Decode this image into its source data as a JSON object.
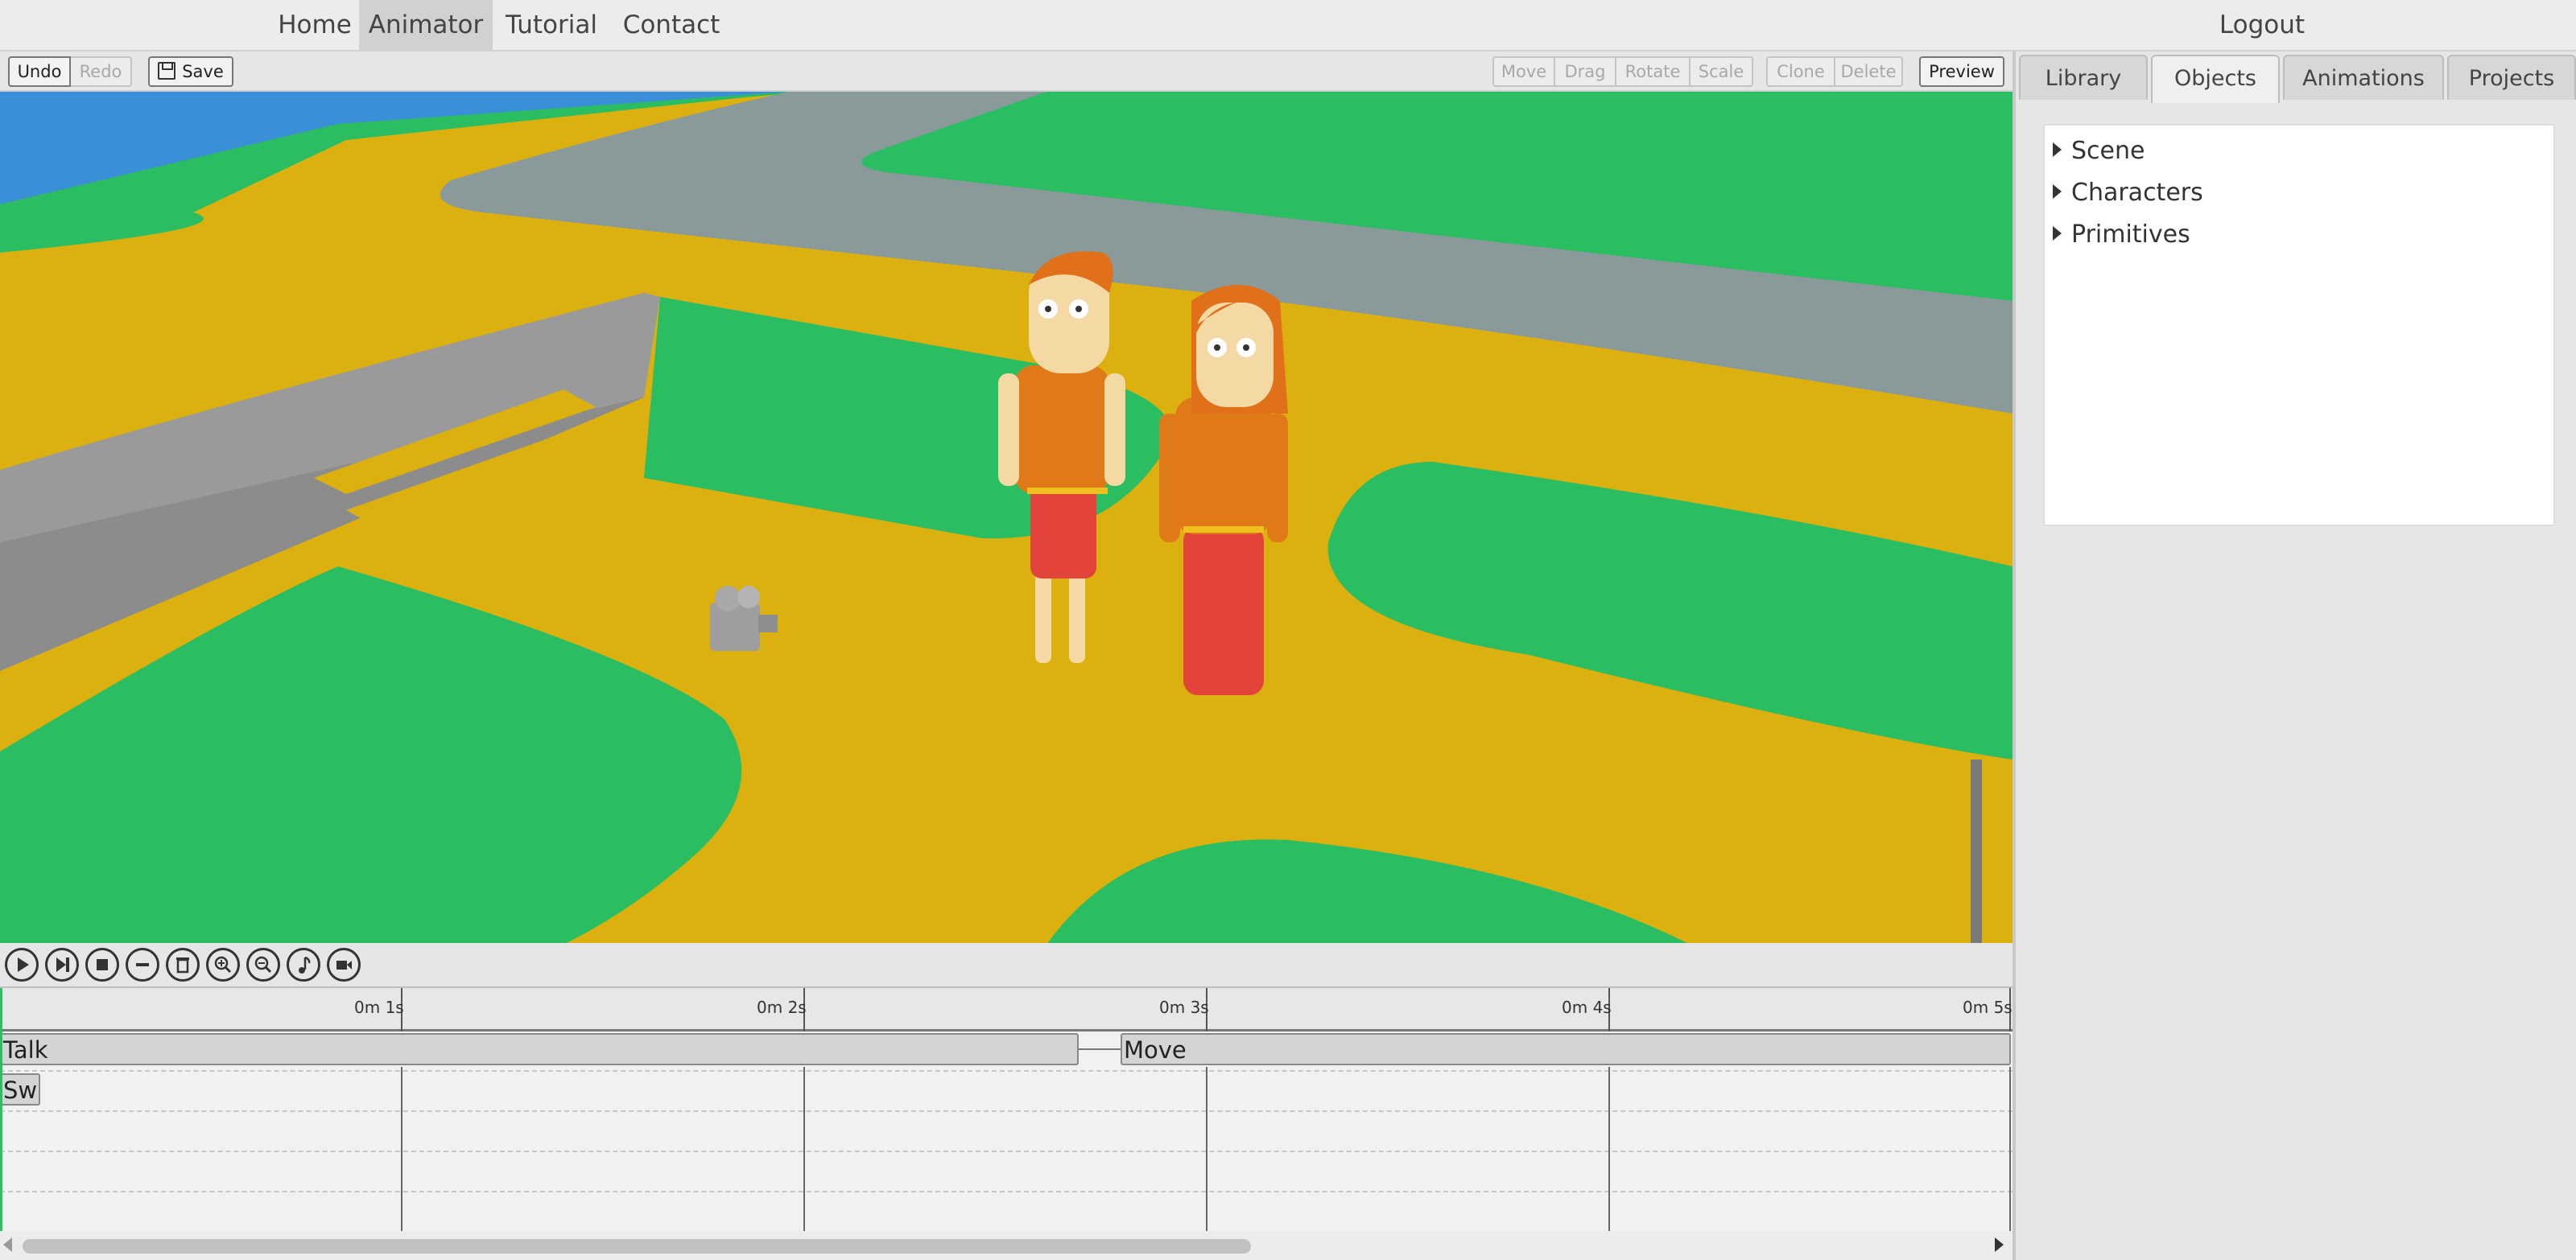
{
  "nav": {
    "home": "Home",
    "animator": "Animator",
    "tutorial": "Tutorial",
    "contact": "Contact",
    "logout": "Logout",
    "active": "Animator"
  },
  "toolbar": {
    "undo": "Undo",
    "redo": "Redo",
    "save": "Save",
    "move": "Move",
    "drag": "Drag",
    "rotate": "Rotate",
    "scale": "Scale",
    "clone": "Clone",
    "delete": "Delete",
    "preview": "Preview"
  },
  "sidebar": {
    "tabs": [
      "Library",
      "Objects",
      "Animations",
      "Projects"
    ],
    "active_tab": "Objects",
    "tree": [
      "Scene",
      "Characters",
      "Primitives"
    ]
  },
  "controls": {
    "icons": [
      "play-icon",
      "step-forward-icon",
      "stop-icon",
      "minus-icon",
      "trash-icon",
      "zoom-in-icon",
      "zoom-out-icon",
      "music-icon",
      "camera-icon"
    ]
  },
  "timeline": {
    "ruler": [
      "0m 1s",
      "0m 2s",
      "0m 3s",
      "0m 4s",
      "0m 5s"
    ],
    "clips": [
      "Talk",
      "Move",
      "Sw"
    ]
  },
  "colors": {
    "grass": "#2bbd62",
    "path": "#dcb00f",
    "road": "#8a9a9b",
    "water": "#3a8fd6",
    "playhead": "#2ec05e"
  }
}
